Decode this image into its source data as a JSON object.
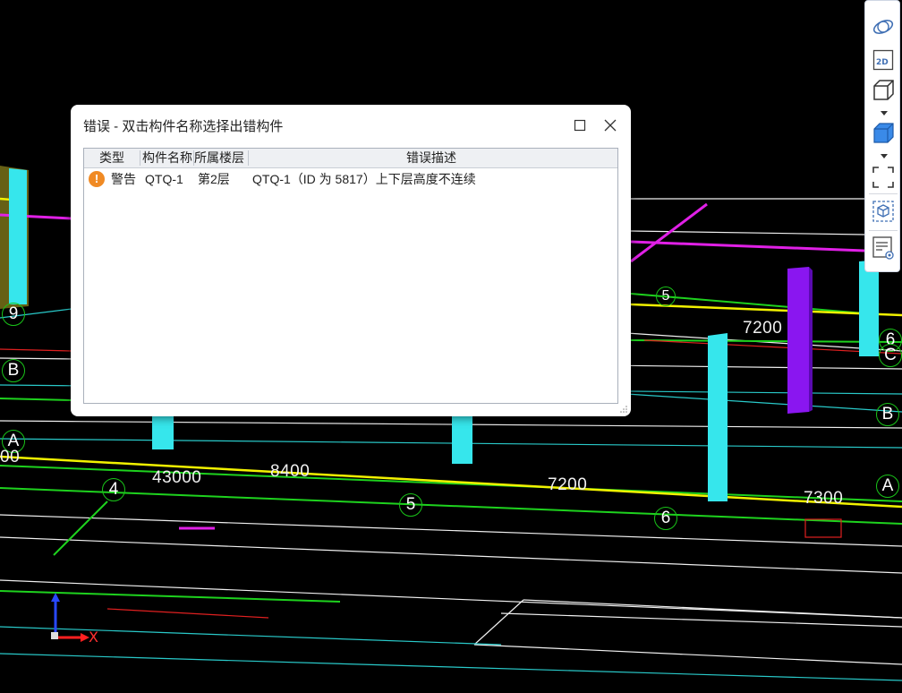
{
  "dialog": {
    "title": "错误 - 双击构件名称选择出错构件",
    "columns": [
      "类型",
      "构件名称",
      "所属楼层",
      "错误描述"
    ],
    "rows": [
      {
        "type": "警告",
        "name": "QTQ-1",
        "floor": "第2层",
        "description": "QTQ-1（ID 为 5817）上下层高度不连续"
      }
    ]
  },
  "toolbar": {
    "icons": [
      "orbit-icon",
      "view-2d-icon",
      "cube-wire-icon",
      "cube-solid-icon",
      "fit-view-icon",
      "box-select-icon",
      "list-view-icon"
    ]
  },
  "viewport": {
    "grid_labels": [
      "9",
      "B",
      "A",
      "4",
      "5",
      "6",
      "5",
      "6",
      "C",
      "B",
      "A"
    ],
    "dimensions": [
      "43000",
      "8400",
      "7200",
      "7200",
      "7300"
    ],
    "partial_dim": "00",
    "axis_x": "X"
  },
  "colors": {
    "background": "#000000",
    "column": "#36e6ec",
    "purple_column": "#8a16f0",
    "yellow_line": "#f2f200",
    "magenta_line": "#e020e6",
    "green_line": "#1ed21e",
    "warning": "#f08a24"
  }
}
